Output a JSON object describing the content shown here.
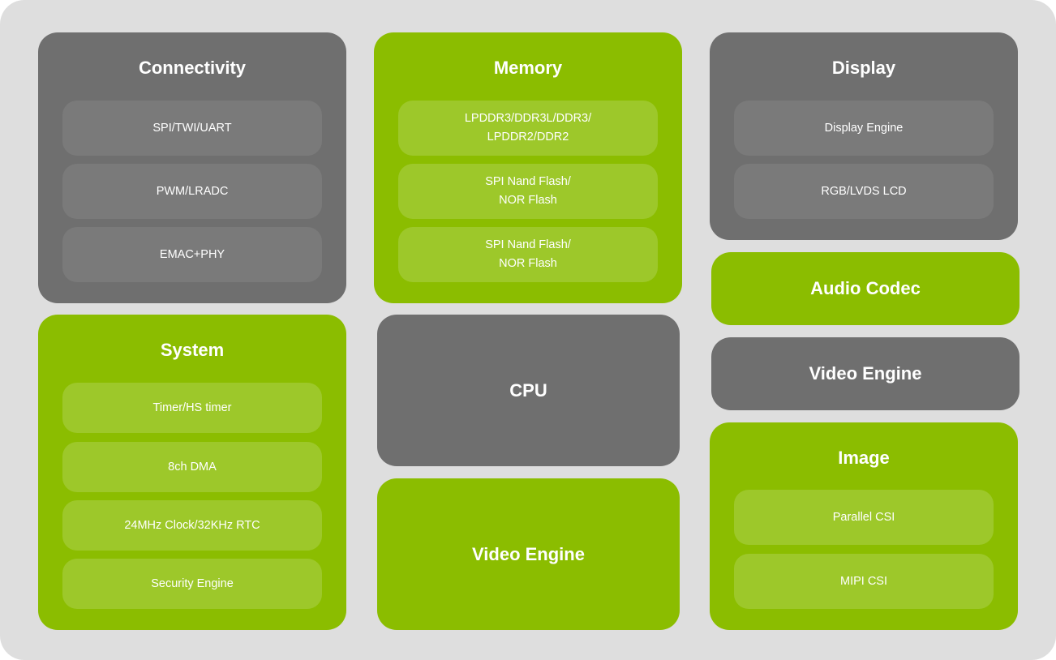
{
  "colors": {
    "background": "#dedede",
    "gray_block": "#6f6f6f",
    "gray_item": "#7a7a7a",
    "green_block": "#8bbd00",
    "green_item": "#9dc82a",
    "text": "#ffffff"
  },
  "connectivity": {
    "title": "Connectivity",
    "items": [
      "SPI/TWI/UART",
      "PWM/LRADC",
      "EMAC+PHY"
    ]
  },
  "system": {
    "title": "System",
    "items": [
      "Timer/HS timer",
      "8ch DMA",
      "24MHz Clock/32KHz RTC",
      "Security Engine"
    ]
  },
  "memory": {
    "title": "Memory",
    "items": [
      "LPDDR3/DDR3L/DDR3/\nLPDDR2/DDR2",
      "SPI Nand Flash/\nNOR Flash",
      "SPI Nand Flash/\nNOR Flash"
    ]
  },
  "cpu": {
    "title": "CPU"
  },
  "video_engine_center": {
    "title": "Video Engine"
  },
  "display": {
    "title": "Display",
    "items": [
      "Display Engine",
      "RGB/LVDS LCD"
    ]
  },
  "audio_codec": {
    "title": "Audio Codec"
  },
  "video_engine_right": {
    "title": "Video Engine"
  },
  "image": {
    "title": "Image",
    "items": [
      "Parallel CSI",
      "MIPI CSI"
    ]
  }
}
